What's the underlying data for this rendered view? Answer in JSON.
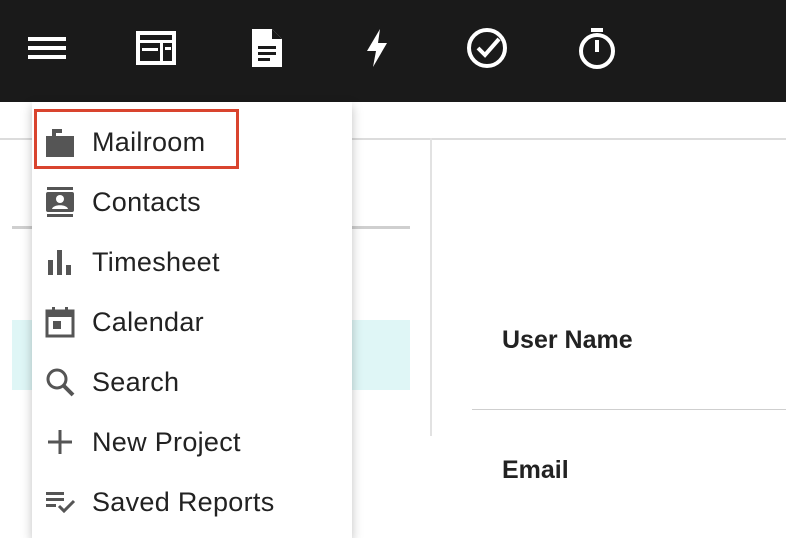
{
  "topbar": {
    "icons": [
      {
        "name": "hamburger-menu-icon"
      },
      {
        "name": "dashboard-icon"
      },
      {
        "name": "document-icon"
      },
      {
        "name": "lightning-icon"
      },
      {
        "name": "check-circle-icon"
      },
      {
        "name": "stopwatch-icon"
      }
    ]
  },
  "menu": {
    "items": [
      {
        "label": "Mailroom",
        "icon": "mailbox-icon",
        "selected": true
      },
      {
        "label": "Contacts",
        "icon": "contacts-icon"
      },
      {
        "label": "Timesheet",
        "icon": "bar-chart-icon"
      },
      {
        "label": "Calendar",
        "icon": "calendar-icon"
      },
      {
        "label": "Search",
        "icon": "search-icon"
      },
      {
        "label": "New Project",
        "icon": "plus-icon"
      },
      {
        "label": "Saved Reports",
        "icon": "saved-reports-icon"
      }
    ]
  },
  "details": {
    "user_name_label": "User Name",
    "email_label": "Email"
  },
  "colors": {
    "topbar": "#1a1a1a",
    "selection_outline": "#d9442e",
    "row_highlight": "#dff6f6"
  }
}
